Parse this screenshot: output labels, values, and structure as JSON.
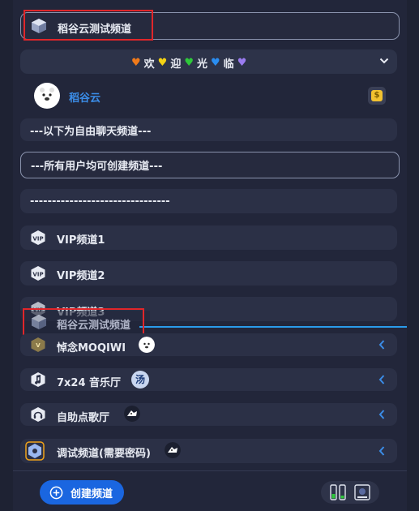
{
  "top_channel": {
    "name": "稻谷云测试频道"
  },
  "welcome": {
    "parts": [
      "欢",
      "迎",
      "光",
      "临"
    ],
    "heart_colors": [
      "#f07a1a",
      "#f4d214",
      "#2ec83a",
      "#2a8df0",
      "#9a7cf0"
    ]
  },
  "user": {
    "name": "稻谷云",
    "badge": "$"
  },
  "text_rows": [
    "---以下为自由聊天频道---",
    "---所有用户均可创建频道---",
    "--------------------------------"
  ],
  "channels": [
    {
      "name": "VIP频道1",
      "icon": "vip-icon"
    },
    {
      "name": "VIP频道2",
      "icon": "vip-icon"
    },
    {
      "name": "VIP频道3",
      "icon": "vip-icon"
    }
  ],
  "dragging": {
    "name": "稻谷云测试频道"
  },
  "user_channels": [
    {
      "name": "悼念MOQIWI",
      "icon": "memorial-icon",
      "avatar_text": ""
    },
    {
      "name": "7x24 音乐厅",
      "icon": "music-note-icon",
      "avatar_text": "汤"
    },
    {
      "name": "自助点歌厅",
      "icon": "headphone-icon",
      "avatar_text": ""
    },
    {
      "name": "调试频道(需要密码)",
      "icon": "settings-icon",
      "avatar_text": ""
    }
  ],
  "footer": {
    "create_label": "创建频道"
  },
  "colors": {
    "accent": "#1a66e0",
    "link": "#3b8de8",
    "drop_line": "#2a9bea",
    "highlight": "#e0262a"
  }
}
